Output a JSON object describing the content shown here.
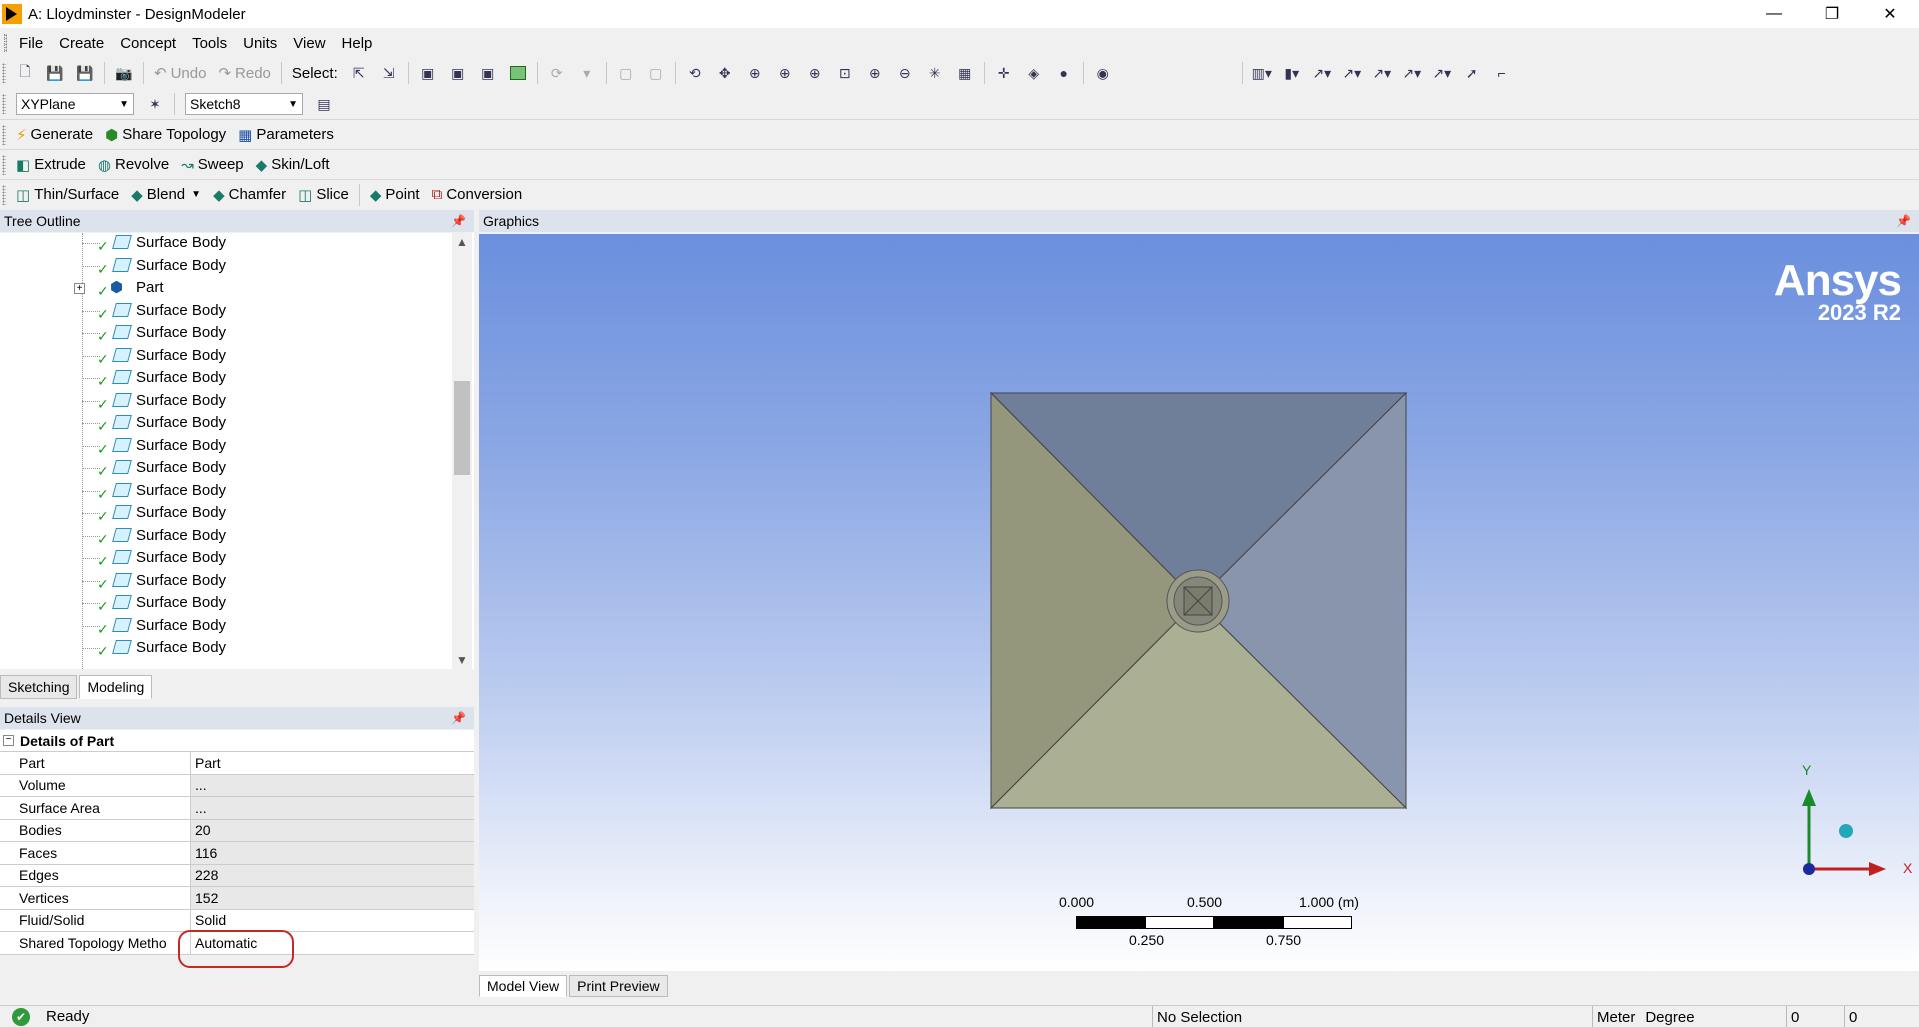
{
  "window": {
    "title": "A: Lloydminster - DesignModeler",
    "minimize": "—",
    "restore": "❐",
    "close": "✕"
  },
  "menu": [
    "File",
    "Create",
    "Concept",
    "Tools",
    "Units",
    "View",
    "Help"
  ],
  "toolbar1": {
    "undo": "Undo",
    "redo": "Redo",
    "select_label": "Select:"
  },
  "toolbar2": {
    "plane": "XYPlane",
    "sketch": "Sketch8"
  },
  "toolbar3": {
    "generate": "Generate",
    "share_topology": "Share Topology",
    "parameters": "Parameters"
  },
  "toolbar4": {
    "extrude": "Extrude",
    "revolve": "Revolve",
    "sweep": "Sweep",
    "skin_loft": "Skin/Loft"
  },
  "toolbar5": {
    "thin_surface": "Thin/Surface",
    "blend": "Blend",
    "chamfer": "Chamfer",
    "slice": "Slice",
    "point": "Point",
    "conversion": "Conversion"
  },
  "tree": {
    "header": "Tree Outline",
    "items": [
      {
        "label": "Surface Body",
        "type": "body"
      },
      {
        "label": "Surface Body",
        "type": "body"
      },
      {
        "label": "Part",
        "type": "part"
      },
      {
        "label": "Surface Body",
        "type": "body"
      },
      {
        "label": "Surface Body",
        "type": "body"
      },
      {
        "label": "Surface Body",
        "type": "body"
      },
      {
        "label": "Surface Body",
        "type": "body"
      },
      {
        "label": "Surface Body",
        "type": "body"
      },
      {
        "label": "Surface Body",
        "type": "body"
      },
      {
        "label": "Surface Body",
        "type": "body"
      },
      {
        "label": "Surface Body",
        "type": "body"
      },
      {
        "label": "Surface Body",
        "type": "body"
      },
      {
        "label": "Surface Body",
        "type": "body"
      },
      {
        "label": "Surface Body",
        "type": "body"
      },
      {
        "label": "Surface Body",
        "type": "body"
      },
      {
        "label": "Surface Body",
        "type": "body"
      },
      {
        "label": "Surface Body",
        "type": "body"
      },
      {
        "label": "Surface Body",
        "type": "body"
      },
      {
        "label": "Surface Body",
        "type": "body"
      }
    ]
  },
  "left_tabs": {
    "sketching": "Sketching",
    "modeling": "Modeling"
  },
  "details": {
    "header": "Details View",
    "group": "Details of Part",
    "rows": [
      {
        "key": "Part",
        "value": "Part"
      },
      {
        "key": "Volume",
        "value": "..."
      },
      {
        "key": "Surface Area",
        "value": "..."
      },
      {
        "key": "Bodies",
        "value": "20"
      },
      {
        "key": "Faces",
        "value": "116"
      },
      {
        "key": "Edges",
        "value": "228"
      },
      {
        "key": "Vertices",
        "value": "152"
      },
      {
        "key": "Fluid/Solid",
        "value": "Solid"
      },
      {
        "key": "Shared Topology Metho",
        "value": "Automatic"
      }
    ]
  },
  "graphics": {
    "header": "Graphics",
    "logo": "Ansys",
    "version": "2023 R2",
    "scale": {
      "t0": "0.000",
      "t1": "0.500",
      "t2": "1.000 (m)",
      "b1": "0.250",
      "b2": "0.750"
    },
    "axes": {
      "x": "X",
      "y": "Y"
    }
  },
  "bottom_tabs": {
    "model_view": "Model View",
    "print_preview": "Print Preview"
  },
  "status": {
    "ready": "Ready",
    "selection": "No Selection",
    "unit_length": "Meter",
    "unit_angle": "Degree",
    "v1": "0",
    "v2": "0"
  },
  "colors": {
    "face_left": "#94977c",
    "face_top": "#6f7f9a",
    "face_right": "#8995ad",
    "face_bottom": "#abaf94"
  }
}
